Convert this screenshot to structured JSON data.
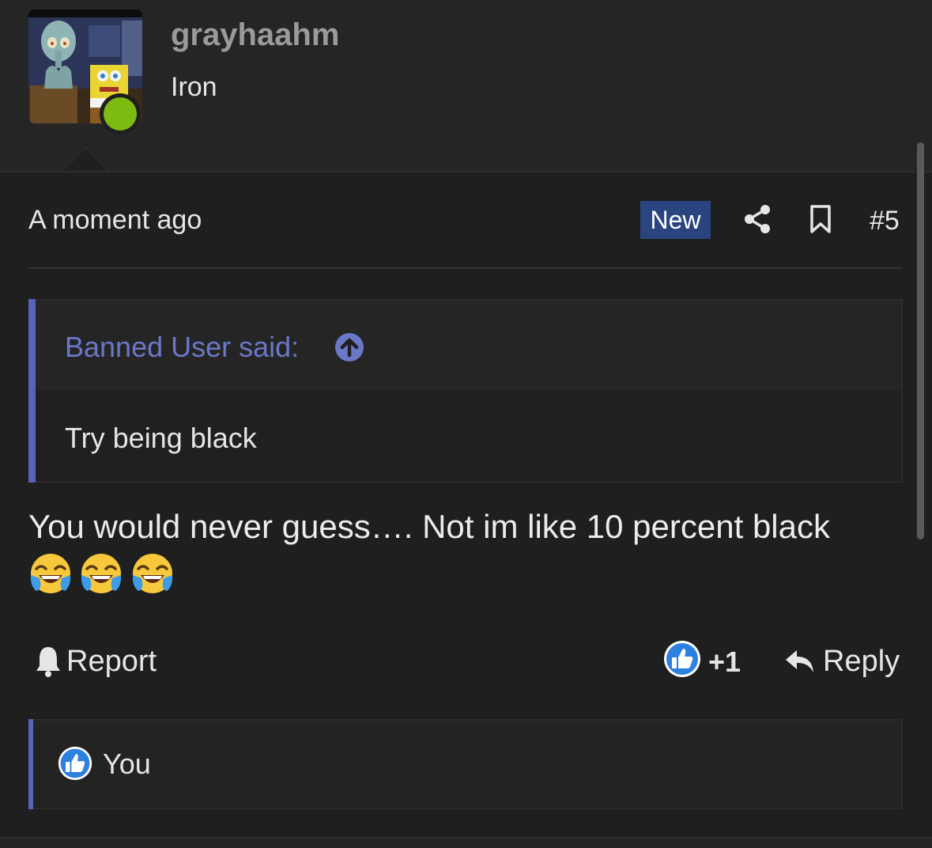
{
  "author": {
    "username": "grayhaahm",
    "title": "Iron",
    "online": true,
    "status_color": "#7dbb12"
  },
  "post": {
    "timestamp": "A moment ago",
    "badge": "New",
    "number": "#5",
    "quote": {
      "author_line": "Banned User said:",
      "text": "Try being black"
    },
    "message": "You would never guess…. Not im like 10 percent black",
    "emojis": [
      "face-with-tears-of-joy",
      "face-with-tears-of-joy",
      "face-with-tears-of-joy"
    ]
  },
  "actions": {
    "report_label": "Report",
    "like_count": "+1",
    "reply_label": "Reply"
  },
  "reactions": {
    "users": [
      "You"
    ]
  },
  "colors": {
    "accent": "#5964b8",
    "badge_bg": "#2a4480",
    "like_blue": "#2d7fe0",
    "quote_author": "#6b78c8"
  },
  "icons": {
    "share": "share-icon",
    "bookmark": "bookmark-icon",
    "jump": "arrow-up-circle-icon",
    "report": "bell-icon",
    "like": "thumbs-up-icon",
    "reply": "reply-arrow-icon"
  }
}
